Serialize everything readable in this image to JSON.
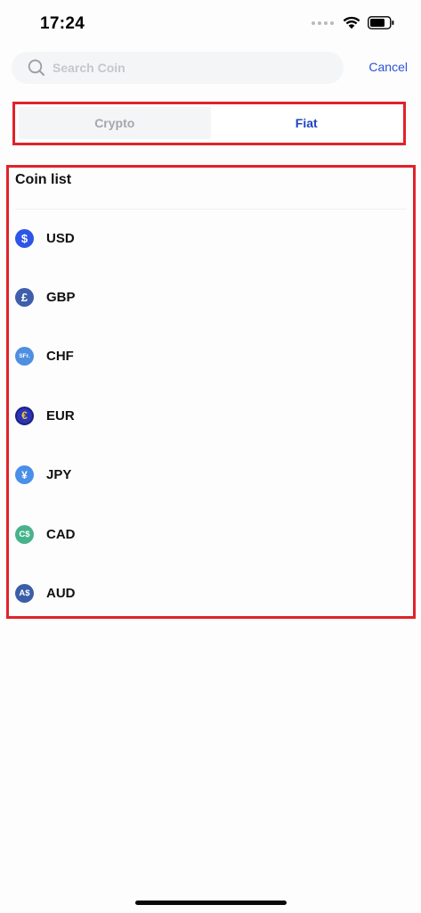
{
  "status_bar": {
    "time": "17:24"
  },
  "search": {
    "placeholder": "Search Coin",
    "value": "",
    "cancel_label": "Cancel"
  },
  "tabs": [
    {
      "label": "Crypto",
      "active": false
    },
    {
      "label": "Fiat",
      "active": true
    }
  ],
  "coin_list": {
    "title": "Coin list",
    "items": [
      {
        "code": "USD",
        "symbol": "$",
        "icon": "dollar-icon",
        "color": "#2e55e8"
      },
      {
        "code": "GBP",
        "symbol": "£",
        "icon": "pound-icon",
        "color": "#3f5eab"
      },
      {
        "code": "CHF",
        "symbol": "SFr.",
        "icon": "franc-icon",
        "color": "#4e8fe0"
      },
      {
        "code": "EUR",
        "symbol": "€",
        "icon": "euro-icon",
        "color": "#2a35b5"
      },
      {
        "code": "JPY",
        "symbol": "¥",
        "icon": "yen-icon",
        "color": "#4a8fe8"
      },
      {
        "code": "CAD",
        "symbol": "C$",
        "icon": "canadian-dollar-icon",
        "color": "#47b38a"
      },
      {
        "code": "AUD",
        "symbol": "A$",
        "icon": "australian-dollar-icon",
        "color": "#3a5fa8"
      }
    ]
  },
  "colors": {
    "accent": "#1f44c4",
    "highlight_outline": "#e0222a"
  }
}
